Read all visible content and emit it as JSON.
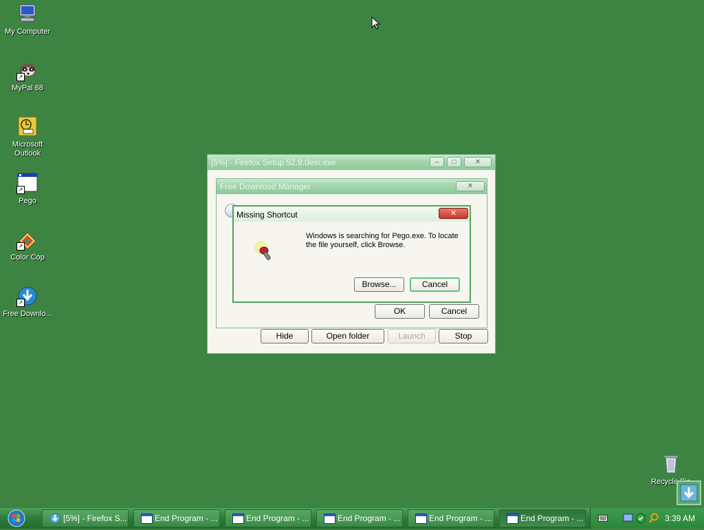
{
  "desktop": {
    "icons": [
      {
        "label": "My Computer"
      },
      {
        "label": "MyPal 68"
      },
      {
        "label": "Microsoft Outlook"
      },
      {
        "label": "Pego"
      },
      {
        "label": "Color Cop"
      },
      {
        "label": "Free Downlo..."
      },
      {
        "label": "Recycle Bin"
      }
    ]
  },
  "firefox_window": {
    "title": "[5%] - Firefox Setup 52.9.0esr.exe"
  },
  "fdm_dialog": {
    "title": "Free Download Manager",
    "ok_label": "OK",
    "cancel_label": "Cancel",
    "hide_label": "Hide",
    "open_folder_label": "Open folder",
    "launch_label": "Launch",
    "stop_label": "Stop"
  },
  "missing_shortcut": {
    "title": "Missing Shortcut",
    "message": "Windows is searching for Pego.exe. To locate the file yourself, click Browse.",
    "browse_label": "Browse...",
    "cancel_label": "Cancel"
  },
  "taskbar": {
    "items": [
      {
        "label": "[5%] - Firefox S..."
      },
      {
        "label": "End Program - ..."
      },
      {
        "label": "End Program - ..."
      },
      {
        "label": "End Program - ..."
      },
      {
        "label": "End Program - ..."
      },
      {
        "label": "End Program - ..."
      }
    ],
    "clock": "3:39 AM"
  }
}
